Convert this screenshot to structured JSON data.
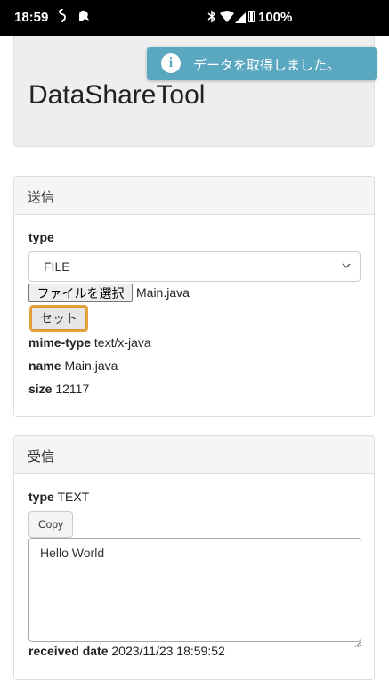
{
  "status_bar": {
    "time": "18:59",
    "battery_pct": "100%",
    "icons": [
      "sim-icon",
      "assistant-icon",
      "bluetooth-icon",
      "wifi-icon",
      "signal-icon",
      "battery-icon"
    ]
  },
  "header": {
    "title": "DataShareTool"
  },
  "toast": {
    "message": "データを取得しました。",
    "icon": "info-icon",
    "color": "#5aa7c0"
  },
  "send": {
    "heading": "送信",
    "type_label": "type",
    "type_selected": "FILE",
    "file_button_label": "ファイルを選択",
    "file_name": "Main.java",
    "set_button_label": "セット",
    "mime_label": "mime-type",
    "mime_value": "text/x-java",
    "name_label": "name",
    "name_value": "Main.java",
    "size_label": "size",
    "size_value": "12117"
  },
  "receive": {
    "heading": "受信",
    "type_label": "type",
    "type_value": "TEXT",
    "copy_button_label": "Copy",
    "text_value": "Hello World",
    "date_label": "received date",
    "date_value": "2023/11/23 18:59:52"
  },
  "colors": {
    "accent_border": "#e6a23c",
    "panel_heading_bg": "#f5f5f5",
    "header_bg": "#eeeeee"
  }
}
